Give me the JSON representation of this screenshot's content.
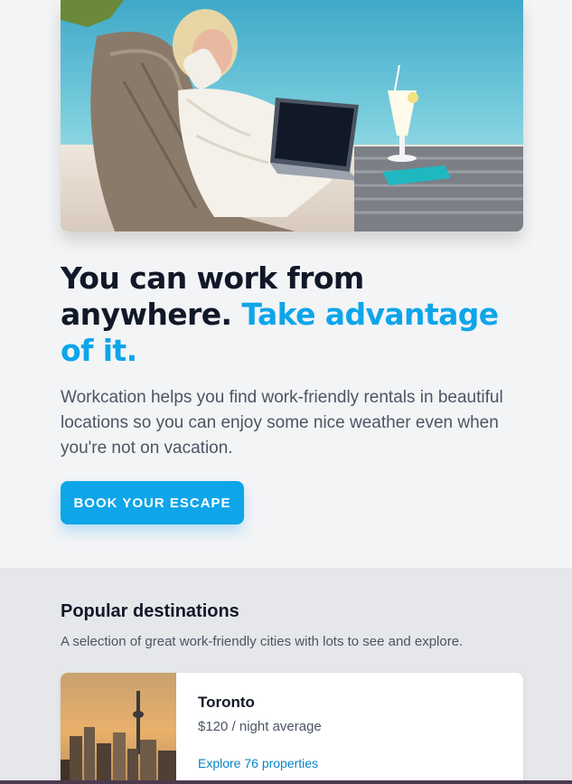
{
  "hero": {
    "image_alt": "Woman working on laptop by the beach",
    "headline": "You can work from anywhere.",
    "headline_accent": "Take advantage of it.",
    "description": "Workcation helps you find work-friendly rentals in beautiful locations so you can enjoy some nice weather even when you're not on vacation.",
    "cta_label": "Book your escape"
  },
  "destinations": {
    "title": "Popular destinations",
    "subtitle": "A selection of great work-friendly cities with lots to see and explore.",
    "items": [
      {
        "city": "Toronto",
        "price": "$120 / night average",
        "link": "Explore 76 properties",
        "image_alt": "Toronto skyline"
      }
    ]
  },
  "colors": {
    "accent": "#0ea5e9",
    "link": "#0284c7",
    "background": "#f3f4f6",
    "section_background": "#e5e7eb"
  }
}
